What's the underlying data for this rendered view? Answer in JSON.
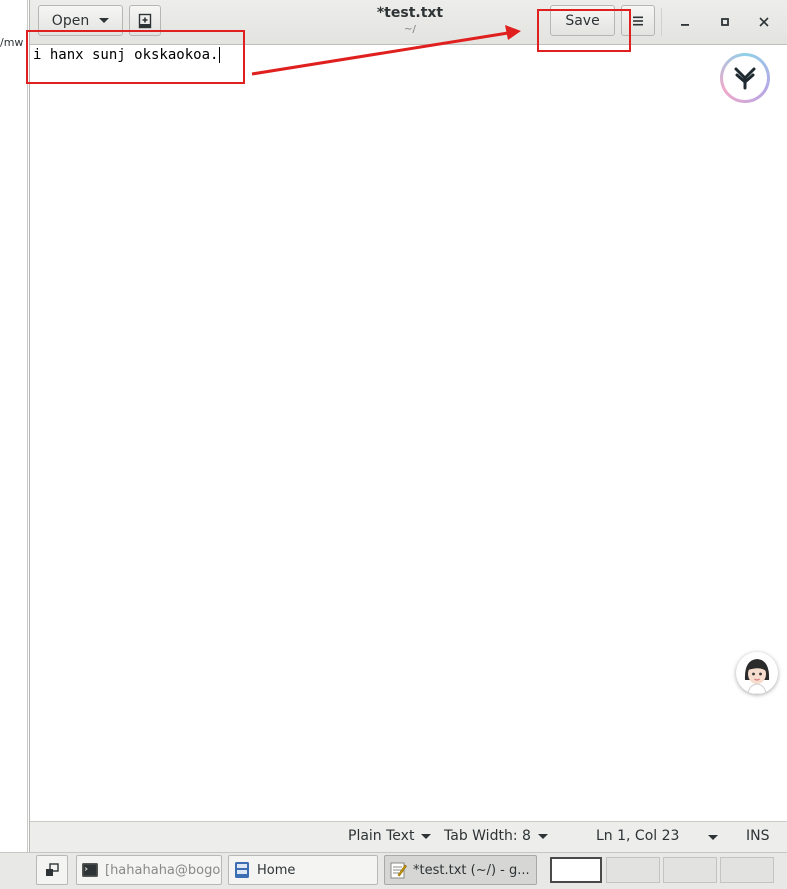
{
  "background_window": {
    "clipped_text": "/mw"
  },
  "headerbar": {
    "open_label": "Open",
    "save_label": "Save",
    "title": "*test.txt",
    "subtitle": "~/"
  },
  "editor": {
    "text": "i hanx sunj okskaokoa."
  },
  "statusbar": {
    "language": "Plain Text",
    "tab_width": "Tab Width: 8",
    "position": "Ln 1, Col 23",
    "mode": "INS"
  },
  "taskbar": {
    "items": [
      {
        "label": "[hahahaha@bogo...",
        "icon": "terminal-icon"
      },
      {
        "label": "Home",
        "icon": "file-manager-icon"
      },
      {
        "label": "*test.txt (~/) - g...",
        "icon": "text-editor-icon"
      }
    ],
    "workspaces": 4
  },
  "annotations": {
    "color": "#e0201e"
  },
  "colors": {
    "headerbar": "#e8e8e6",
    "taskbar": "#e8e8e7"
  }
}
